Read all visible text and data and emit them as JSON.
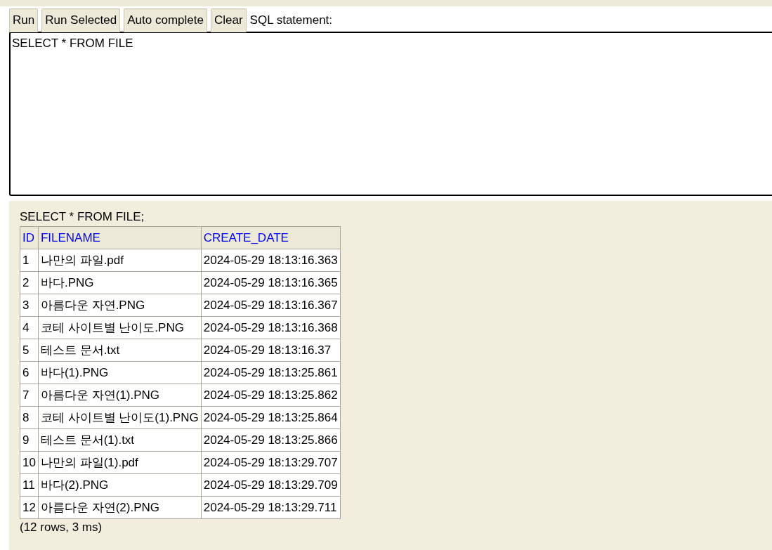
{
  "toolbar": {
    "buttons": [
      "Run",
      "Run Selected",
      "Auto complete",
      "Clear"
    ],
    "label": "SQL statement:"
  },
  "editor": {
    "value": "SELECT * FROM FILE "
  },
  "result": {
    "query": "SELECT * FROM FILE;",
    "columns": [
      "ID",
      "FILENAME",
      "CREATE_DATE"
    ],
    "rows": [
      [
        "1",
        "나만의 파일.pdf",
        "2024-05-29 18:13:16.363"
      ],
      [
        "2",
        "바다.PNG",
        "2024-05-29 18:13:16.365"
      ],
      [
        "3",
        "아름다운 자연.PNG",
        "2024-05-29 18:13:16.367"
      ],
      [
        "4",
        "코테 사이트별 난이도.PNG",
        "2024-05-29 18:13:16.368"
      ],
      [
        "5",
        "테스트 문서.txt",
        "2024-05-29 18:13:16.37"
      ],
      [
        "6",
        "바다(1).PNG",
        "2024-05-29 18:13:25.861"
      ],
      [
        "7",
        "아름다운 자연(1).PNG",
        "2024-05-29 18:13:25.862"
      ],
      [
        "8",
        "코테 사이트별 난이도(1).PNG",
        "2024-05-29 18:13:25.864"
      ],
      [
        "9",
        "테스트 문서(1).txt",
        "2024-05-29 18:13:25.866"
      ],
      [
        "10",
        "나만의 파일(1).pdf",
        "2024-05-29 18:13:29.707"
      ],
      [
        "11",
        "바다(2).PNG",
        "2024-05-29 18:13:29.709"
      ],
      [
        "12",
        "아름다운 자연(2).PNG",
        "2024-05-29 18:13:29.711"
      ]
    ],
    "summary": "(12 rows, 3 ms)"
  }
}
